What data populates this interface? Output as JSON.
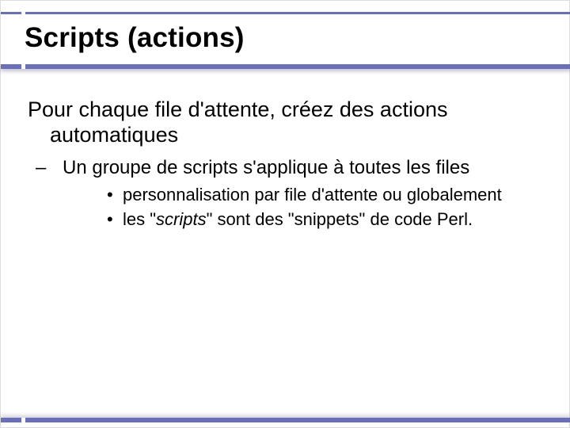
{
  "slide": {
    "title": "Scripts (actions)",
    "main_point": "Pour chaque file d'attente, créez des actions automatiques",
    "sub_item": "Un groupe de scripts s'applique à toutes les files",
    "bullets": [
      "personnalisation par file d'attente ou globalement",
      "les \"scripts\" sont des \"snippets\" de code Perl."
    ],
    "bullet2_parts": {
      "pre": "les \"",
      "italic": "scripts",
      "post": "\" sont des \"snippets\" de code Perl."
    }
  },
  "colors": {
    "accent": "#6a6fb8"
  }
}
